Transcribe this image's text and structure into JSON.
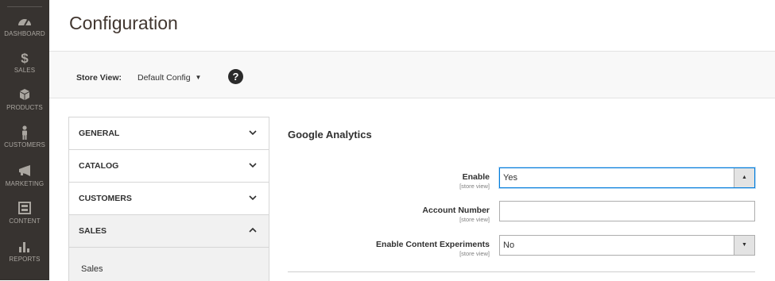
{
  "sidebar": {
    "items": [
      {
        "label": "DASHBOARD",
        "icon": "dashboard-icon"
      },
      {
        "label": "SALES",
        "icon": "dollar-icon"
      },
      {
        "label": "PRODUCTS",
        "icon": "cube-icon"
      },
      {
        "label": "CUSTOMERS",
        "icon": "person-icon"
      },
      {
        "label": "MARKETING",
        "icon": "megaphone-icon"
      },
      {
        "label": "CONTENT",
        "icon": "layout-icon"
      },
      {
        "label": "REPORTS",
        "icon": "bar-chart-icon"
      }
    ]
  },
  "page": {
    "title": "Configuration"
  },
  "store_bar": {
    "label": "Store View:",
    "value": "Default Config"
  },
  "tabs": [
    {
      "label": "GENERAL",
      "state": "collapsed"
    },
    {
      "label": "CATALOG",
      "state": "collapsed"
    },
    {
      "label": "CUSTOMERS",
      "state": "collapsed"
    },
    {
      "label": "SALES",
      "state": "expanded"
    }
  ],
  "sales_sub": {
    "label": "Sales"
  },
  "section": {
    "title": "Google Analytics",
    "fields": [
      {
        "label": "Enable",
        "scope": "[store view]",
        "value": "Yes",
        "type": "select"
      },
      {
        "label": "Account Number",
        "scope": "[store view]",
        "value": "",
        "type": "text"
      },
      {
        "label": "Enable Content Experiments",
        "scope": "[store view]",
        "value": "No",
        "type": "select"
      }
    ]
  },
  "colors": {
    "sidebar_bg": "#373330",
    "focus": "#007bdb"
  }
}
